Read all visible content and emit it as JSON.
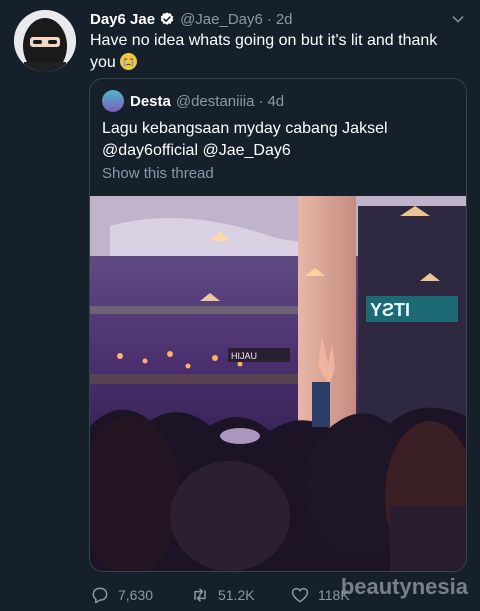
{
  "tweet": {
    "author_name": "Day6 Jae",
    "author_handle": "@Jae_Day6",
    "time": "2d",
    "text": "Have no idea whats going on but it's lit and thank you",
    "quoted": {
      "author_name": "Desta",
      "author_handle": "@destaniiia",
      "time": "4d",
      "text_line1": "Lagu kebangsaan myday cabang Jaksel",
      "text_line2": "@day6official @Jae_Day6",
      "show_thread": "Show this thread"
    },
    "stats": {
      "replies": "7,630",
      "retweets": "51.2K",
      "likes": "118K"
    }
  },
  "icons": {
    "verified": "verified-badge-icon",
    "chevron": "chevron-down-icon",
    "emoji": "crying-face-emoji",
    "reply": "reply-icon",
    "retweet": "retweet-icon",
    "like": "heart-icon"
  },
  "watermark": "beautynesia",
  "colors": {
    "background": "#15202b",
    "secondary_text": "#8899a6",
    "border": "#38444d",
    "verified": "#ffffff"
  }
}
